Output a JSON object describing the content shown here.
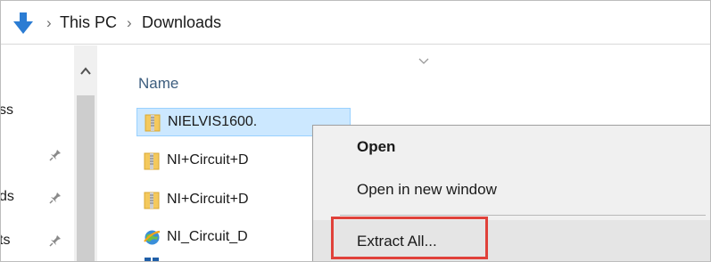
{
  "breadcrumb": {
    "nav_icon": "down-arrow-icon",
    "separator": "›",
    "items": [
      "This PC",
      "Downloads"
    ]
  },
  "nav_pane": {
    "items": [
      {
        "label": "ss",
        "pinned": false
      },
      {
        "label": "",
        "pinned": true
      },
      {
        "label": "ds",
        "pinned": true
      },
      {
        "label": "ts",
        "pinned": true
      }
    ]
  },
  "file_list": {
    "column_name": "Name",
    "files": [
      {
        "name": "NIELVIS1600.",
        "icon": "zip-folder-icon",
        "selected": true
      },
      {
        "name": "NI+Circuit+D",
        "icon": "zip-folder-icon",
        "selected": false
      },
      {
        "name": "NI+Circuit+D",
        "icon": "zip-folder-icon",
        "selected": false
      },
      {
        "name": "NI_Circuit_D",
        "icon": "globe-shortcut-icon",
        "selected": false
      }
    ]
  },
  "context_menu": {
    "items": [
      {
        "label": "Open",
        "default": true
      },
      {
        "label": "Open in new window",
        "default": false
      },
      {
        "label": "Extract All...",
        "default": false
      }
    ]
  },
  "colors": {
    "selection_bg": "#cce8ff",
    "highlight_border": "#e0413a",
    "arrow_blue": "#2b7cd3"
  }
}
